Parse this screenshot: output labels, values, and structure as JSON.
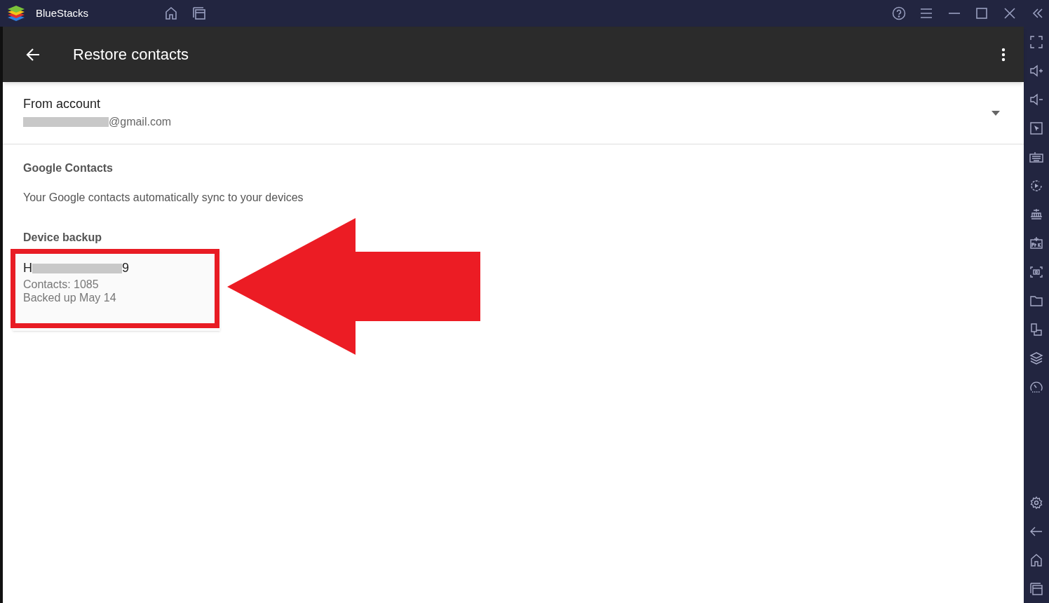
{
  "window": {
    "title": "BlueStacks"
  },
  "app_bar": {
    "title": "Restore contacts"
  },
  "account": {
    "label": "From account",
    "email_suffix": "@gmail.com"
  },
  "sections": [
    {
      "heading": "Google Contacts",
      "description": "Your Google contacts automatically sync to your devices"
    },
    {
      "heading": "Device backup"
    }
  ],
  "backups": [
    {
      "name_start": "H",
      "name_end": "9",
      "contacts": "Contacts: 1085",
      "date": "Backed up May 14"
    }
  ]
}
